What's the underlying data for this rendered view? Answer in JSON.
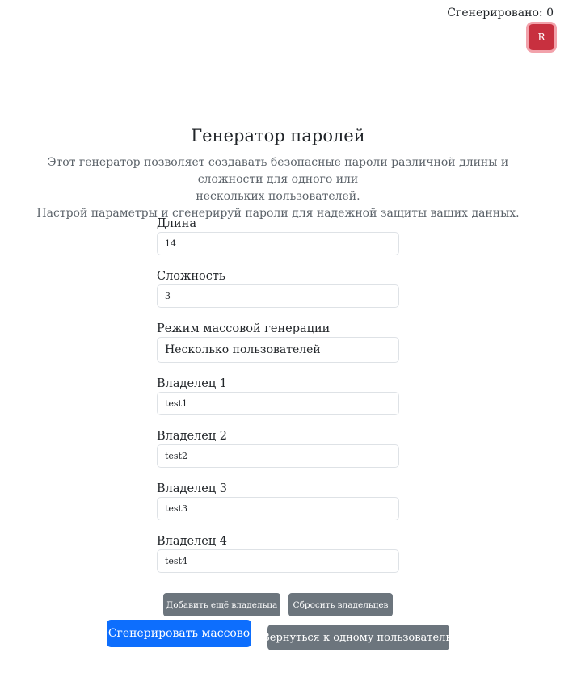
{
  "header": {
    "counter_text": "Сгенерировано: 0",
    "avatar_letter": "R",
    "avatar_color": "#c8303f"
  },
  "main": {
    "title": "Генератор паролей",
    "description_line1": "Этот генератор позволяет создавать безопасные пароли различной длины и сложности для одного или",
    "description_line2": "нескольких пользователей.",
    "description_line3": "Настрой параметры и сгенерируй пароли для надежной защиты ваших данных."
  },
  "form": {
    "length_label": "Длина",
    "length_value": "14",
    "complexity_label": "Сложность",
    "complexity_value": "3",
    "mode_label": "Режим массовой генерации",
    "mode_value": "Несколько пользователей",
    "owners": [
      {
        "label": "Владелец 1",
        "value": "test1"
      },
      {
        "label": "Владелец 2",
        "value": "test2"
      },
      {
        "label": "Владелец 3",
        "value": "test3"
      },
      {
        "label": "Владелец 4",
        "value": "test4"
      }
    ]
  },
  "actions": {
    "add_owner_label": "Добавить ещё владельца",
    "reset_owners_label": "Сбросить владельцев",
    "generate_bulk_label": "Сгенерировать массово",
    "back_single_label": "Вернуться к одному пользователю"
  },
  "colors": {
    "primary": "#0d6efd",
    "secondary": "#6c757d",
    "avatar": "#c8303f"
  }
}
